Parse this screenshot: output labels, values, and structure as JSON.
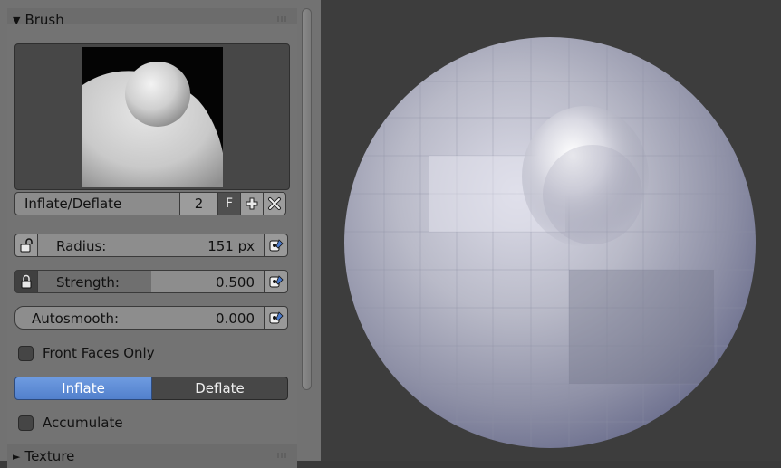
{
  "panels": {
    "brush": {
      "title": "Brush",
      "arrow": "▼",
      "brush_name": "Inflate/Deflate",
      "users": "2",
      "fake_user": "F",
      "add": "+",
      "remove": "✕",
      "radius": {
        "label": "Radius:",
        "value": "151 px",
        "locked": false,
        "fill_fraction": 0.0
      },
      "strength": {
        "label": "Strength:",
        "value": "0.500",
        "locked": true,
        "fill_fraction": 0.5
      },
      "autosmooth": {
        "label": "Autosmooth:",
        "value": "0.000",
        "fill_fraction": 0.0
      },
      "front_faces_only": {
        "label": "Front Faces Only",
        "checked": false
      },
      "direction": {
        "inflate": "Inflate",
        "deflate": "Deflate",
        "selected": "Inflate"
      },
      "accumulate": {
        "label": "Accumulate",
        "checked": false
      }
    },
    "texture": {
      "title": "Texture",
      "arrow": "►"
    }
  },
  "icons": {
    "lock": "lock-icon",
    "pen_pressure": "pen-pressure-icon",
    "add": "add-icon",
    "remove": "remove-icon"
  },
  "colors": {
    "panel_bg": "#727272",
    "viewport_bg": "#3d3d3d",
    "accent": "#5e8ad4"
  }
}
